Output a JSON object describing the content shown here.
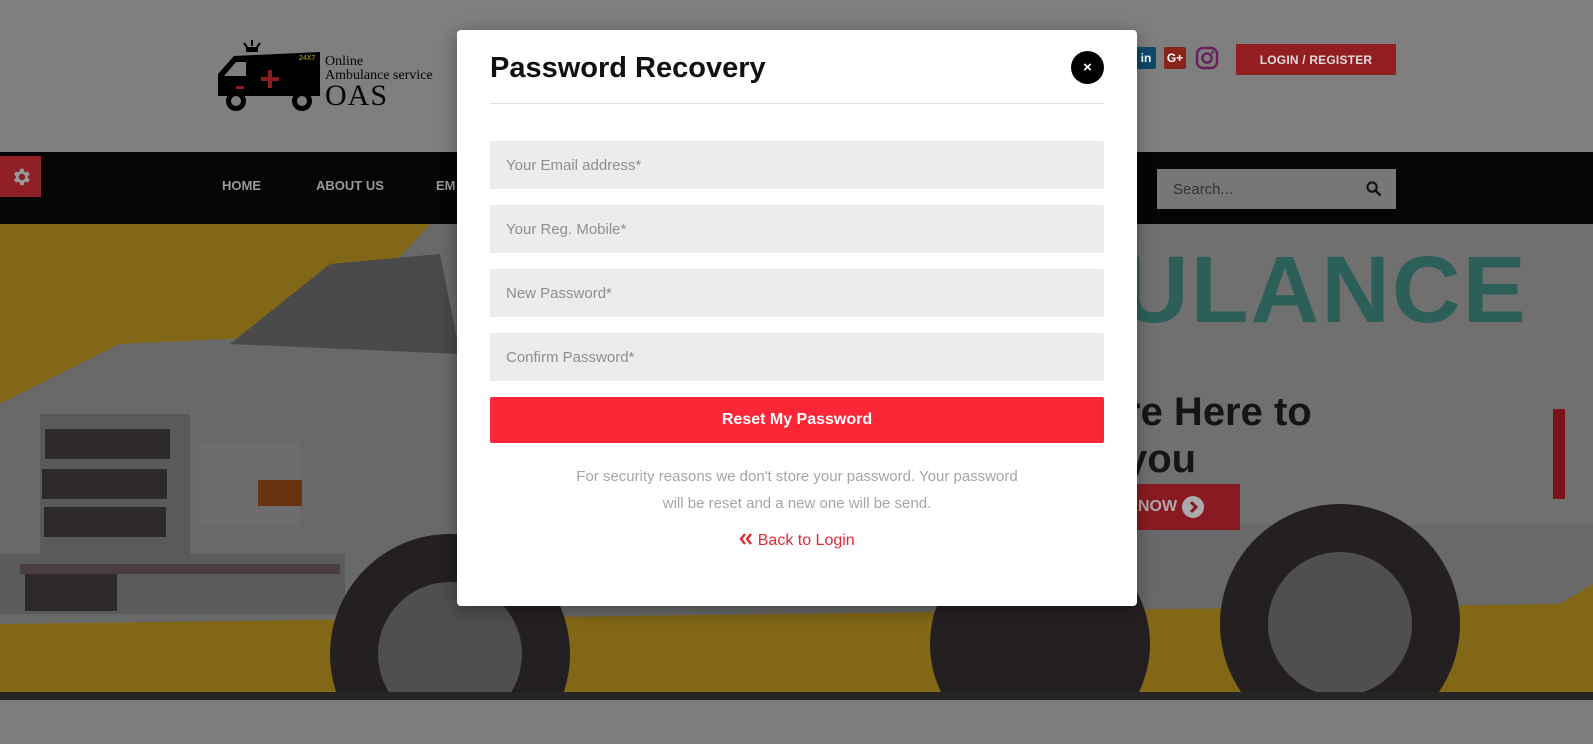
{
  "header": {
    "logo": {
      "line1": "Online",
      "line2": "Ambulance service",
      "line3": "OAS",
      "badge": "24X7"
    },
    "social_icons": [
      "linkedin-icon",
      "google-plus-icon",
      "instagram-icon"
    ],
    "social_labels": {
      "linkedin": "in",
      "google_plus": "G+"
    },
    "login_label": "LOGIN / REGISTER"
  },
  "nav": {
    "items": [
      "HOME",
      "ABOUT US",
      "EM"
    ],
    "search_placeholder": "Search..."
  },
  "hero": {
    "big_text": "ULANCE",
    "tagline_line1": "re Here to",
    "tagline_line2": "you",
    "button_label": "NOW"
  },
  "modal": {
    "title": "Password Recovery",
    "close_label": "×",
    "fields": {
      "email_placeholder": "Your Email address*",
      "mobile_placeholder": "Your Reg. Mobile*",
      "new_password_placeholder": "New Password*",
      "confirm_password_placeholder": "Confirm Password*"
    },
    "reset_label": "Reset My Password",
    "note_line1": "For security reasons we don't store your password. Your password",
    "note_line2": "will be reset and a new one will be send.",
    "back_label": "Back to Login"
  },
  "colors": {
    "accent": "#fd2637",
    "link": "#e42a34",
    "close_bg": "#000000",
    "field_bg": "#ececec"
  }
}
